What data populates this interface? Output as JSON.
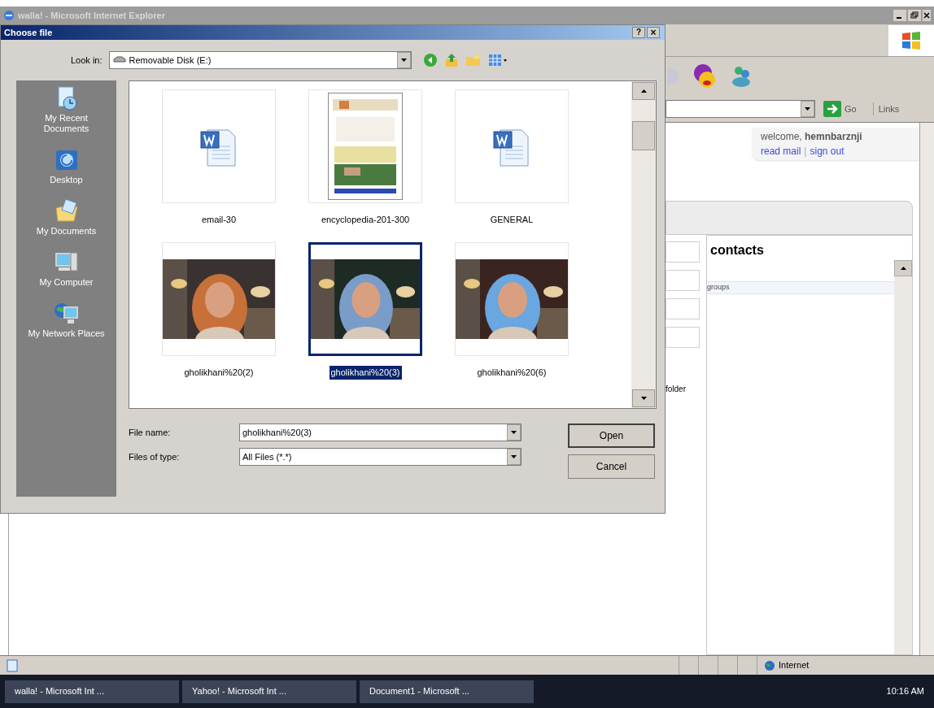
{
  "browser": {
    "title": "walla! - Microsoft Internet Explorer",
    "address_bar": {
      "go": "Go",
      "links": "Links"
    },
    "account": {
      "welcome": "welcome, **hemnbarznji**",
      "read_mail": "read mail",
      "separator": "|",
      "sign_out": "sign out"
    },
    "page_text": "folder",
    "contacts": {
      "title": "contacts",
      "items": [
        "groups"
      ]
    },
    "status_bar": {
      "zone": "Internet"
    }
  },
  "dialog": {
    "title": "Choose file",
    "help": "?",
    "close": "×",
    "look_in": {
      "label": "Look in:",
      "value": "Removable Disk (E:)"
    },
    "places": [
      {
        "label": "My Recent Documents",
        "kind": "recent"
      },
      {
        "label": "Desktop",
        "kind": "desktop"
      },
      {
        "label": "My Documents",
        "kind": "documents"
      },
      {
        "label": "My Computer",
        "kind": "computer"
      },
      {
        "label": "My Network Places",
        "kind": "network"
      }
    ],
    "files": [
      {
        "name": "email-30",
        "kind": "document",
        "selected": false
      },
      {
        "name": "encyclopedia-201-300",
        "kind": "webpage",
        "selected": false
      },
      {
        "name": "GENERAL",
        "kind": "document",
        "selected": false
      },
      {
        "name": "gholikhani%20(2)",
        "kind": "picture",
        "selected": false
      },
      {
        "name": "gholikhani%20(3)",
        "kind": "picture",
        "selected": true
      },
      {
        "name": "gholikhani%20(6)",
        "kind": "picture",
        "selected": false
      }
    ],
    "file_name": {
      "label": "File name:",
      "value": "gholikhani%20(3)"
    },
    "file_type": {
      "label": "Files of type:",
      "value": "All Files (*.*)"
    },
    "buttons": [
      "Open",
      "Cancel"
    ]
  },
  "taskbar": {
    "tasks": [
      {
        "label": "walla! - Microsoft Int ...",
        "selected": false
      },
      {
        "label": "Yahoo! - Microsoft Int ...",
        "selected": false
      },
      {
        "label": "Document1 - Microsoft ...",
        "selected": false
      }
    ],
    "clock": "10:16 AM"
  }
}
